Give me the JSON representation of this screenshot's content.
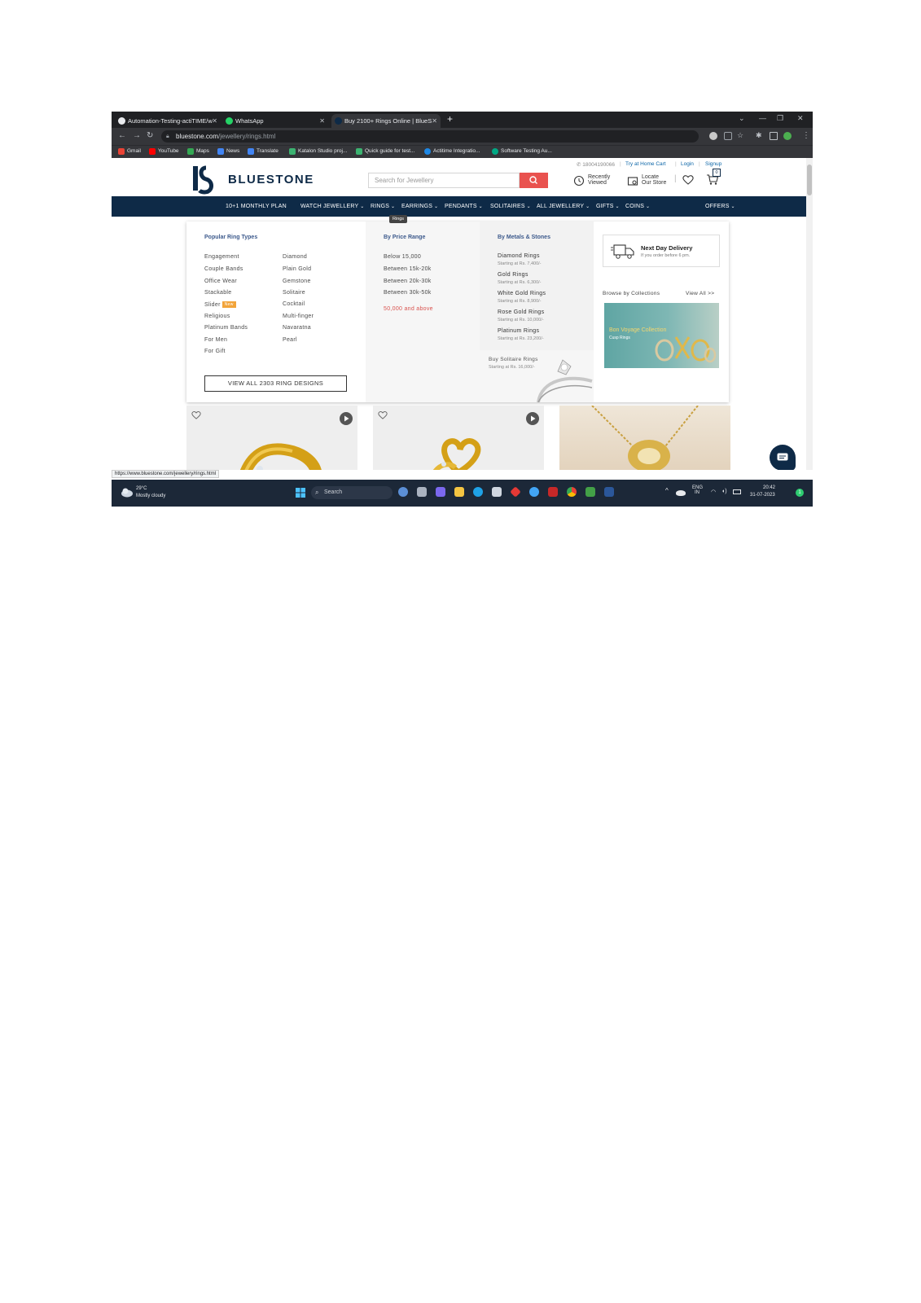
{
  "browser": {
    "tabs": [
      {
        "title": "Automation-Testing-actiTIME/w"
      },
      {
        "title": "WhatsApp"
      },
      {
        "title": "Buy 2100+ Rings Online | BlueS"
      }
    ],
    "url_domain": "bluestone.com",
    "url_path": "/jewellery/rings.html",
    "bookmarks": [
      "Gmail",
      "YouTube",
      "Maps",
      "News",
      "Translate",
      "Katalon Studio proj...",
      "Quick guide for test...",
      "Actitime Integratio...",
      "Software Testing Au..."
    ]
  },
  "site": {
    "phone": "18004190066",
    "utility_links": [
      "Try at Home Cart",
      "Login",
      "Signup"
    ],
    "logo": "BLUESTONE",
    "search_placeholder": "Search for Jewellery",
    "recently_viewed": [
      "Recently",
      "Viewed"
    ],
    "locate_store": [
      "Locate",
      "Our Store"
    ],
    "cart_count": "0",
    "nav": [
      "10+1 MONTHLY PLAN",
      "WATCH JEWELLERY",
      "RINGS",
      "EARRINGS",
      "PENDANTS",
      "SOLITAIRES",
      "ALL JEWELLERY",
      "GIFTS",
      "COINS",
      "OFFERS"
    ],
    "tooltip": "Rings"
  },
  "menu": {
    "popular_heading": "Popular Ring Types",
    "popular_col1": [
      "Engagement",
      "Couple Bands",
      "Office Wear",
      "Stackable",
      "Slider",
      "Religious",
      "Platinum Bands",
      "For Men",
      "For Gift"
    ],
    "popular_col2": [
      "Diamond",
      "Plain Gold",
      "Gemstone",
      "Solitaire",
      "Cocktail",
      "Multi-finger",
      "Navaratna",
      "Pearl"
    ],
    "new_badge": "New",
    "view_all": "VIEW ALL 2303 RING DESIGNS",
    "price_heading": "By Price Range",
    "price_ranges": [
      "Below 15,000",
      "Between 15k-20k",
      "Between 20k-30k",
      "Between 30k-50k",
      "50,000 and above"
    ],
    "metal_heading": "By Metals & Stones",
    "metals": [
      {
        "name": "Diamond Rings",
        "price": "Starting at Rs. 7,400/-"
      },
      {
        "name": "Gold Rings",
        "price": "Starting at Rs. 6,300/-"
      },
      {
        "name": "White Gold Rings",
        "price": "Starting at Rs. 8,900/-"
      },
      {
        "name": "Rose Gold Rings",
        "price": "Starting at Rs. 10,000/-"
      },
      {
        "name": "Platinum Rings",
        "price": "Starting at Rs. 23,200/-"
      }
    ],
    "solitaire_title": "Buy Solitaire Rings",
    "solitaire_price": "Starting at Rs. 16,000/-",
    "delivery_title": "Next Day Delivery",
    "delivery_sub": "If you order before 6 pm.",
    "collections_heading": "Browse by Collections",
    "collections_viewall": "View All >>",
    "collection_title": "Bon Voyage Collection",
    "collection_sub": "Cusp Rings"
  },
  "status_url": "https://www.bluestone.com/jewellery/rings.html",
  "taskbar": {
    "weather_temp": "29°C",
    "weather_desc": "Mostly cloudy",
    "search": "Search",
    "lang": [
      "ENG",
      "IN"
    ],
    "time": "20:42",
    "date": "31-07-2023",
    "notif": "1"
  },
  "colors": {
    "navy": "#0e2a47",
    "accent_red": "#e9524f",
    "menu_heading": "#3d5a8c",
    "badge": "#f2a43a"
  }
}
